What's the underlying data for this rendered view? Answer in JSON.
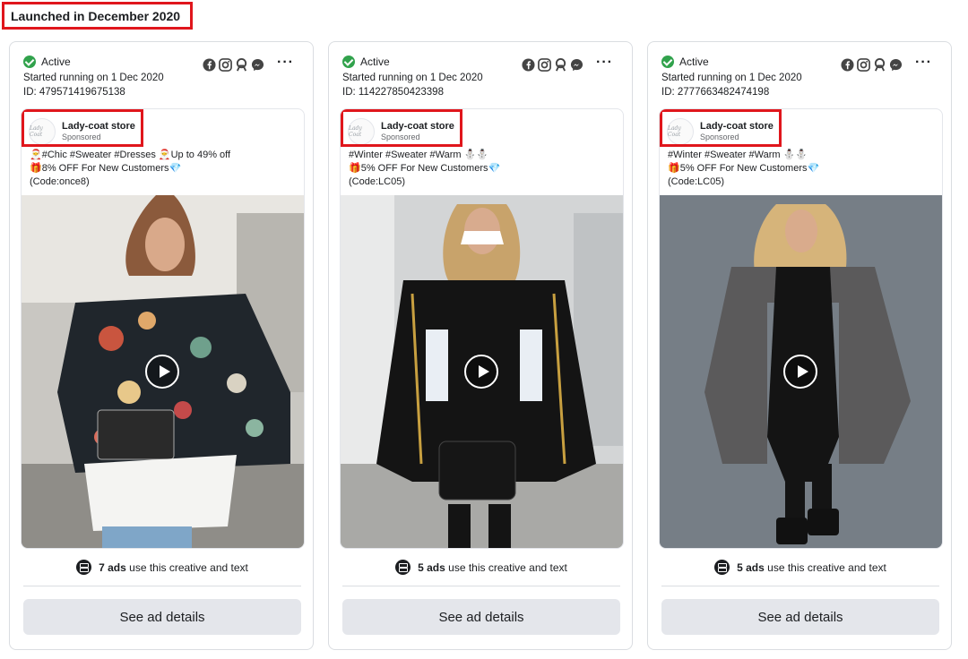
{
  "section": {
    "title": "Launched in December 2020"
  },
  "cards": [
    {
      "status": "Active",
      "started": "Started running on 1 Dec 2020",
      "id": "ID: 479571419675138",
      "advertiser": "Lady-coat store",
      "sponsored": "Sponsored",
      "avatar_text": "Lady Coat",
      "copy": [
        "🎅#Chic #Sweater #Dresses 🎅Up to 49% off",
        "🎁8% OFF For New Customers💎",
        "(Code:once8)"
      ],
      "ads_count": "7 ads",
      "ads_suffix": "use this creative and text",
      "button": "See ad details"
    },
    {
      "status": "Active",
      "started": "Started running on 1 Dec 2020",
      "id": "ID: 114227850423398",
      "advertiser": "Lady-coat store",
      "sponsored": "Sponsored",
      "avatar_text": "Lady Coat",
      "copy": [
        "#Winter #Sweater #Warm ⛄⛄",
        "🎁5% OFF For New Customers💎",
        "(Code:LC05)"
      ],
      "ads_count": "5 ads",
      "ads_suffix": "use this creative and text",
      "button": "See ad details"
    },
    {
      "status": "Active",
      "started": "Started running on 1 Dec 2020",
      "id": "ID: 2777663482474198",
      "advertiser": "Lady-coat store",
      "sponsored": "Sponsored",
      "avatar_text": "Lady Coat",
      "copy": [
        "#Winter #Sweater #Warm ⛄⛄",
        "🎁5% OFF For New Customers💎",
        "(Code:LC05)"
      ],
      "ads_count": "5 ads",
      "ads_suffix": "use this creative and text",
      "button": "See ad details"
    }
  ],
  "platform_icons": [
    "facebook-icon",
    "instagram-icon",
    "audience-network-icon",
    "messenger-icon"
  ],
  "colors": {
    "highlight": "#e0161c",
    "active": "#31a24c",
    "button_bg": "#e4e6eb"
  }
}
